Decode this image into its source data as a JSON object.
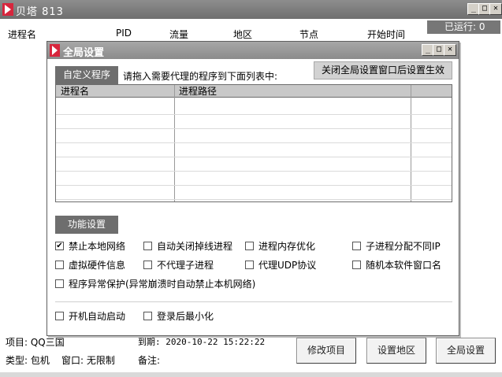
{
  "main": {
    "title": "贝塔 813",
    "runtime": "已运行: 0",
    "columns": [
      "进程名",
      "PID",
      "流量",
      "地区",
      "节点",
      "开始时间"
    ],
    "project_label": "项目: QQ三国",
    "expire_label": "到期: 2020-10-22 15:22:22",
    "type_label": "类型: 包机",
    "window_label": "窗口: 无限制",
    "note_label": "备注:",
    "buttons": {
      "modify_project": "修改项目",
      "set_region": "设置地区",
      "global_settings": "全局设置"
    }
  },
  "win_controls": {
    "minimize": "_",
    "maximize": "□",
    "close": "✕"
  },
  "dialog": {
    "title": "全局设置",
    "custom_program": "自定义程序",
    "hint": "请拖入需要代理的程序到下面列表中:",
    "apply_note": "关闭全局设置窗口后设置生效",
    "table_headers": [
      "进程名",
      "进程路径",
      ""
    ],
    "function_settings": "功能设置",
    "options": [
      {
        "label": "禁止本地网络",
        "checked": true
      },
      {
        "label": "自动关闭掉线进程",
        "checked": false
      },
      {
        "label": "进程内存优化",
        "checked": false
      },
      {
        "label": "子进程分配不同IP",
        "checked": false
      },
      {
        "label": "虚拟硬件信息",
        "checked": false
      },
      {
        "label": "不代理子进程",
        "checked": false
      },
      {
        "label": "代理UDP协议",
        "checked": false
      },
      {
        "label": "随机本软件窗口名",
        "checked": false
      },
      {
        "label": "程序异常保护(异常崩溃时自动禁止本机网络)",
        "checked": false
      },
      {
        "label": "开机自动启动",
        "checked": false
      },
      {
        "label": "登录后最小化",
        "checked": false
      }
    ]
  },
  "colors": {
    "titlebar": "#7f7f7f",
    "dark_button": "#6e6e6e",
    "header_row": "#c8c8c8",
    "logo": "#d7263d"
  }
}
